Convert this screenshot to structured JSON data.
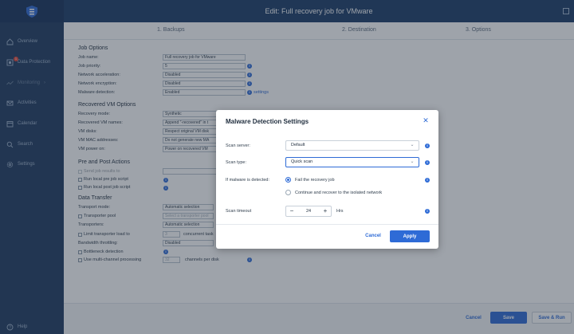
{
  "window": {
    "title": "Edit: Full recovery job for VMware"
  },
  "sidebar": {
    "items": [
      {
        "label": "Overview",
        "icon": "home-icon"
      },
      {
        "label": "Data Protection",
        "icon": "data-protection-icon",
        "badge": "1"
      },
      {
        "label": "Monitoring",
        "icon": "monitoring-icon",
        "suffix": "›"
      },
      {
        "label": "Activities",
        "icon": "activities-icon"
      },
      {
        "label": "Calendar",
        "icon": "calendar-icon"
      },
      {
        "label": "Search",
        "icon": "search-icon"
      },
      {
        "label": "Settings",
        "icon": "gear-icon"
      },
      {
        "label": "Help",
        "icon": "help-icon"
      }
    ]
  },
  "steps": [
    {
      "label": "1. Backups"
    },
    {
      "label": "2. Destination"
    },
    {
      "label": "3. Options"
    }
  ],
  "job_options": {
    "heading": "Job Options",
    "rows": [
      {
        "label": "Job name:",
        "value": "Full recovery job for VMware"
      },
      {
        "label": "Job priority:",
        "value": "5"
      },
      {
        "label": "Network acceleration:",
        "value": "Disabled"
      },
      {
        "label": "Network encryption:",
        "value": "Disabled"
      },
      {
        "label": "Malware detection:",
        "value": "Enabled",
        "link": "settings"
      }
    ]
  },
  "recovered_vm": {
    "heading": "Recovered VM Options",
    "rows": [
      {
        "label": "Recovery mode:",
        "value": "Synthetic"
      },
      {
        "label": "Recovered VM names:",
        "value": "Append \"-recovered\" in t"
      },
      {
        "label": "VM disks:",
        "value": "Respect original VM disk"
      },
      {
        "label": "VM MAC addresses:",
        "value": "Do not generate new MA"
      },
      {
        "label": "VM power on:",
        "value": "Power on recovered VM"
      }
    ]
  },
  "pre_post": {
    "heading": "Pre and Post Actions",
    "rows": [
      {
        "label": "Send job results to"
      },
      {
        "label": "Run local pre job script"
      },
      {
        "label": "Run local post job script"
      }
    ]
  },
  "data_transfer": {
    "heading": "Data Transfer",
    "rows": [
      {
        "label": "Transport mode:",
        "value": "Automatic selection"
      },
      {
        "label": "Transporter pool",
        "value": "Select a transporter pool"
      },
      {
        "label": "Transporters:",
        "value": "Automatic selection"
      },
      {
        "label": "Limit transporter load to",
        "value": "3",
        "suffix": "concurrent task"
      },
      {
        "label": "Bandwidth throttling:",
        "value": "Disabled"
      },
      {
        "label": "Bottleneck detection"
      },
      {
        "label": "Use multi-channel processing",
        "value": "32",
        "suffix": "channels per disk"
      }
    ]
  },
  "footer": {
    "cancel": "Cancel",
    "save": "Save",
    "save_run": "Save & Run"
  },
  "dialog": {
    "title": "Malware Detection Settings",
    "scan_server_label": "Scan server:",
    "scan_server_value": "Default",
    "scan_type_label": "Scan type:",
    "scan_type_value": "Quick scan",
    "if_detected_label": "If malware is detected:",
    "option_fail": "Fail the recovery job",
    "option_continue": "Continue and recover to the isolated network",
    "timeout_label": "Scan timeout",
    "timeout_value": "24",
    "timeout_unit": "Hrs",
    "cancel": "Cancel",
    "apply": "Apply"
  },
  "colors": {
    "accent": "#2e6bd6",
    "sidebar": "#1e3a5f",
    "topbar": "#1b3b66"
  }
}
